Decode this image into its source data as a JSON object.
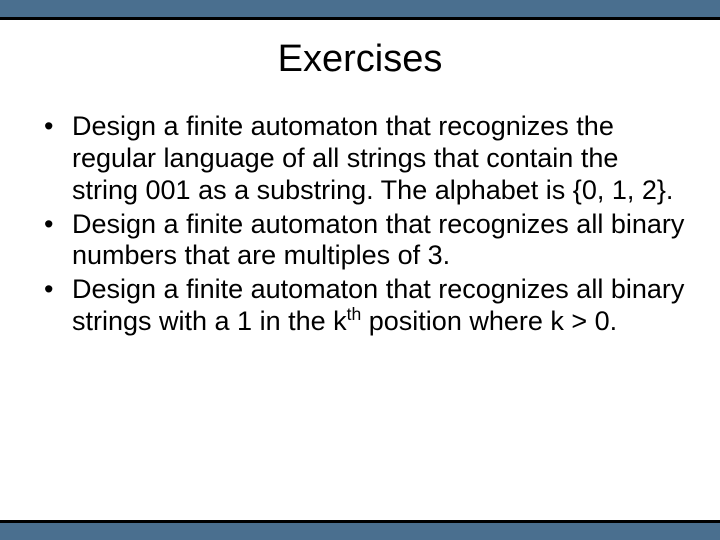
{
  "title": "Exercises",
  "bullets": [
    {
      "text": "Design a finite automaton that recognizes the regular language of all strings that contain the string 001 as a substring.  The alphabet is {0, 1, 2}."
    },
    {
      "text": "Design a finite automaton that recognizes all binary numbers that are multiples of 3."
    },
    {
      "prefix": "Design a finite automaton that recognizes all binary strings with a 1 in the k",
      "sup": "th",
      "suffix": " position where k > 0."
    }
  ]
}
